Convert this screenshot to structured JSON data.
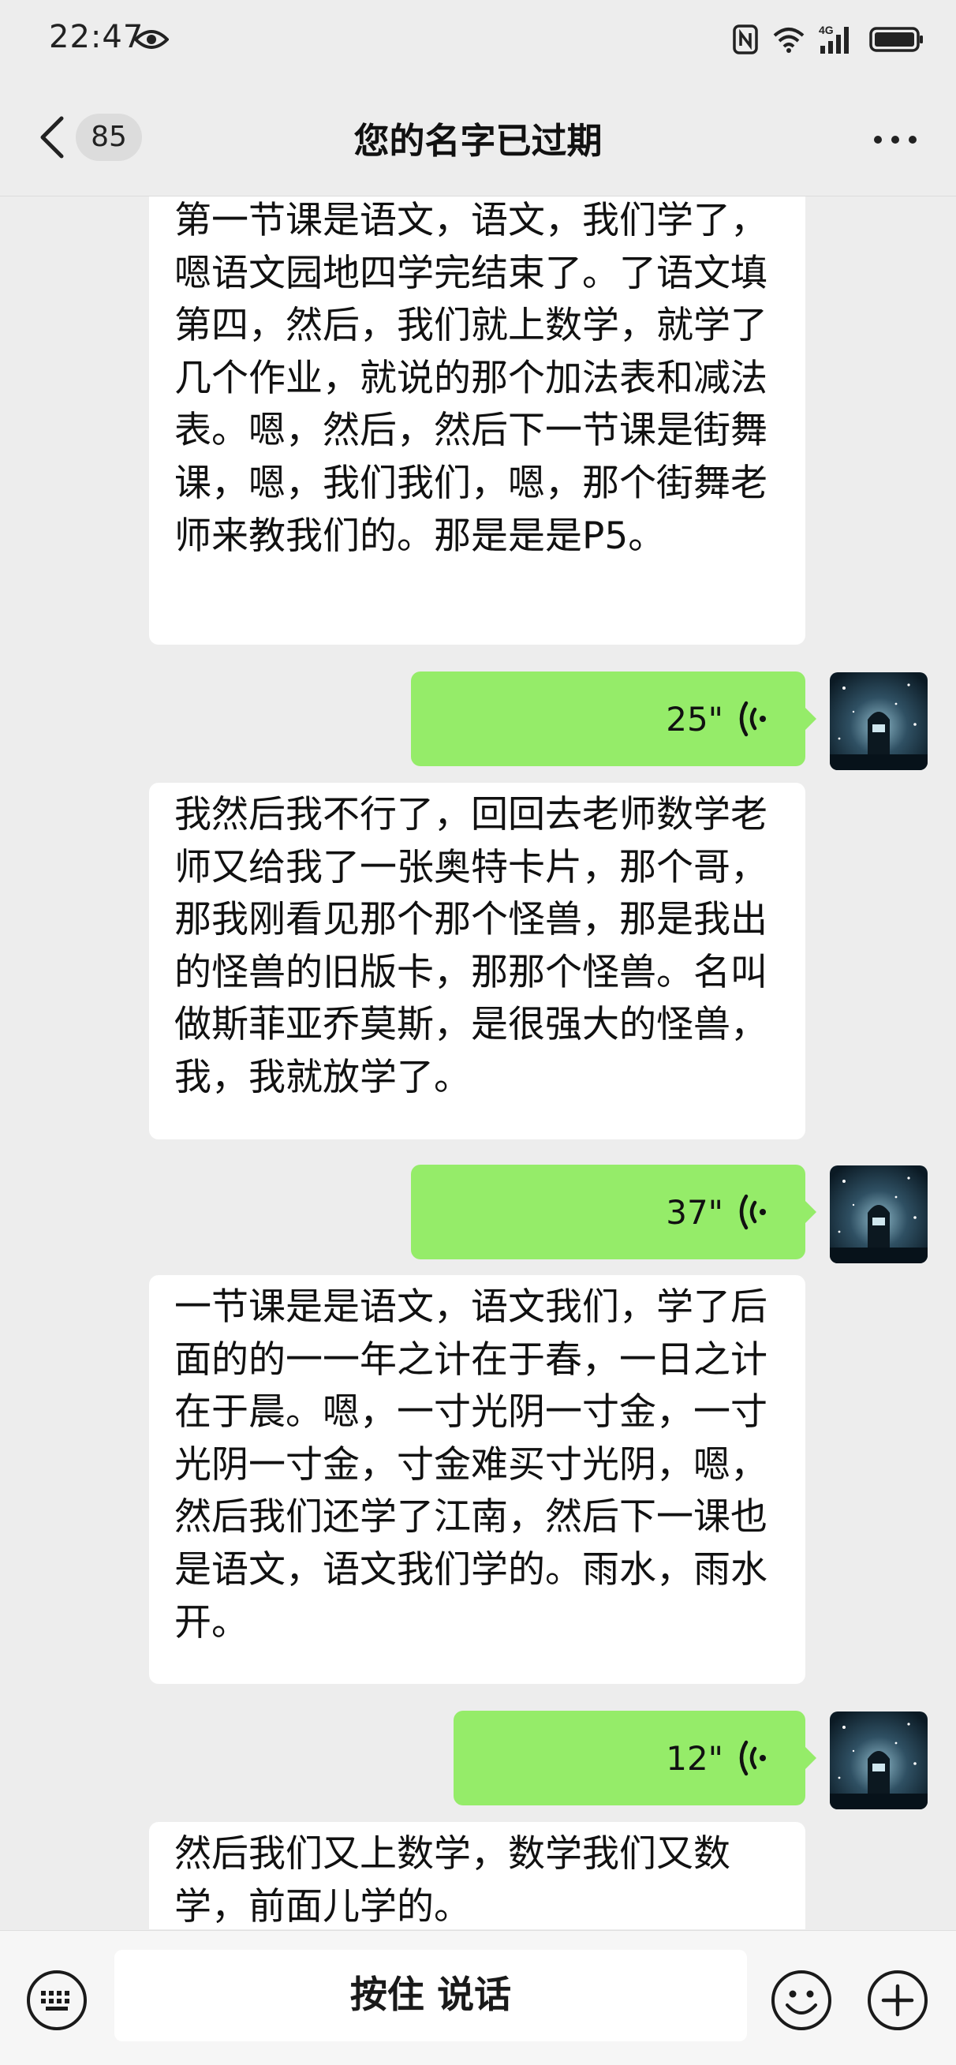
{
  "status_bar": {
    "time": "22:47"
  },
  "nav": {
    "unread_count": "85",
    "title": "您的名字已过期"
  },
  "messages": [
    {
      "type": "text",
      "side": "left",
      "text": "第一节课是语文，语文，我们学了，嗯语文园地四学完结束了。了语文填第四，然后，我们就上数学，就学了几个作业，就说的那个加法表和减法表。嗯，然后，然后下一节课是街舞课，嗯，我们我们，嗯，那个街舞老师来教我们的。那是是是P5。"
    },
    {
      "type": "voice",
      "side": "right",
      "duration": "25\""
    },
    {
      "type": "text",
      "side": "left",
      "text": "我然后我不行了，回回去老师数学老师又给我了一张奥特卡片，那个哥，那我刚看见那个那个怪兽，那是我出的怪兽的旧版卡，那那个怪兽。名叫做斯菲亚乔莫斯，是很强大的怪兽，我，我就放学了。"
    },
    {
      "type": "voice",
      "side": "right",
      "duration": "37\""
    },
    {
      "type": "text",
      "side": "left",
      "text": "一节课是是语文，语文我们，学了后面的的一一年之计在于春，一日之计在于晨。嗯，一寸光阴一寸金，一寸光阴一寸金，寸金难买寸光阴，嗯，然后我们还学了江南，然后下一课也是语文，语文我们学的。雨水，雨水开。"
    },
    {
      "type": "voice",
      "side": "right",
      "duration": "12\""
    },
    {
      "type": "text",
      "side": "left",
      "text": "然后我们又上数学，数学我们又数学，前面儿学的。"
    }
  ],
  "input_bar": {
    "hold_to_talk": "按住 说话"
  },
  "colors": {
    "voice_bubble": "#95ec69",
    "background": "#ededed"
  }
}
